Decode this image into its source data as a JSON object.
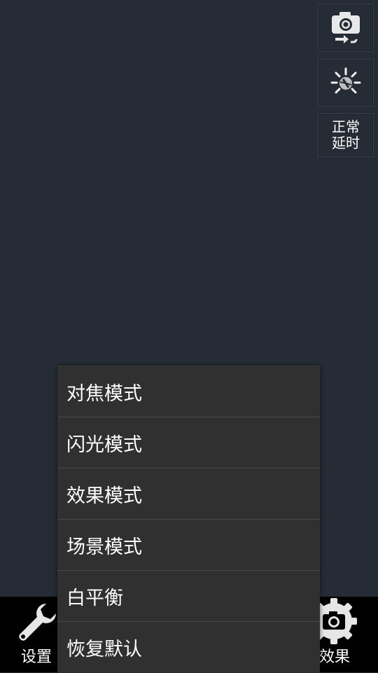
{
  "side_controls": {
    "switch_camera_icon": "camera-switch-icon",
    "flash_icon": "flash-auto-icon",
    "timer_line1": "正常",
    "timer_line2": "延时"
  },
  "bottom_bar": {
    "settings_label": "设置",
    "settings_icon": "wrench-icon",
    "effects_label": "效果",
    "effects_icon": "gear-camera-icon"
  },
  "menu": {
    "items": [
      {
        "label": "对焦模式"
      },
      {
        "label": "闪光模式"
      },
      {
        "label": "效果模式"
      },
      {
        "label": "场景模式"
      },
      {
        "label": "白平衡"
      },
      {
        "label": "恢复默认"
      }
    ]
  },
  "colors": {
    "background": "#262c35",
    "menu_background": "#303030",
    "bottom_bar": "#000000",
    "text": "#ffffff"
  }
}
